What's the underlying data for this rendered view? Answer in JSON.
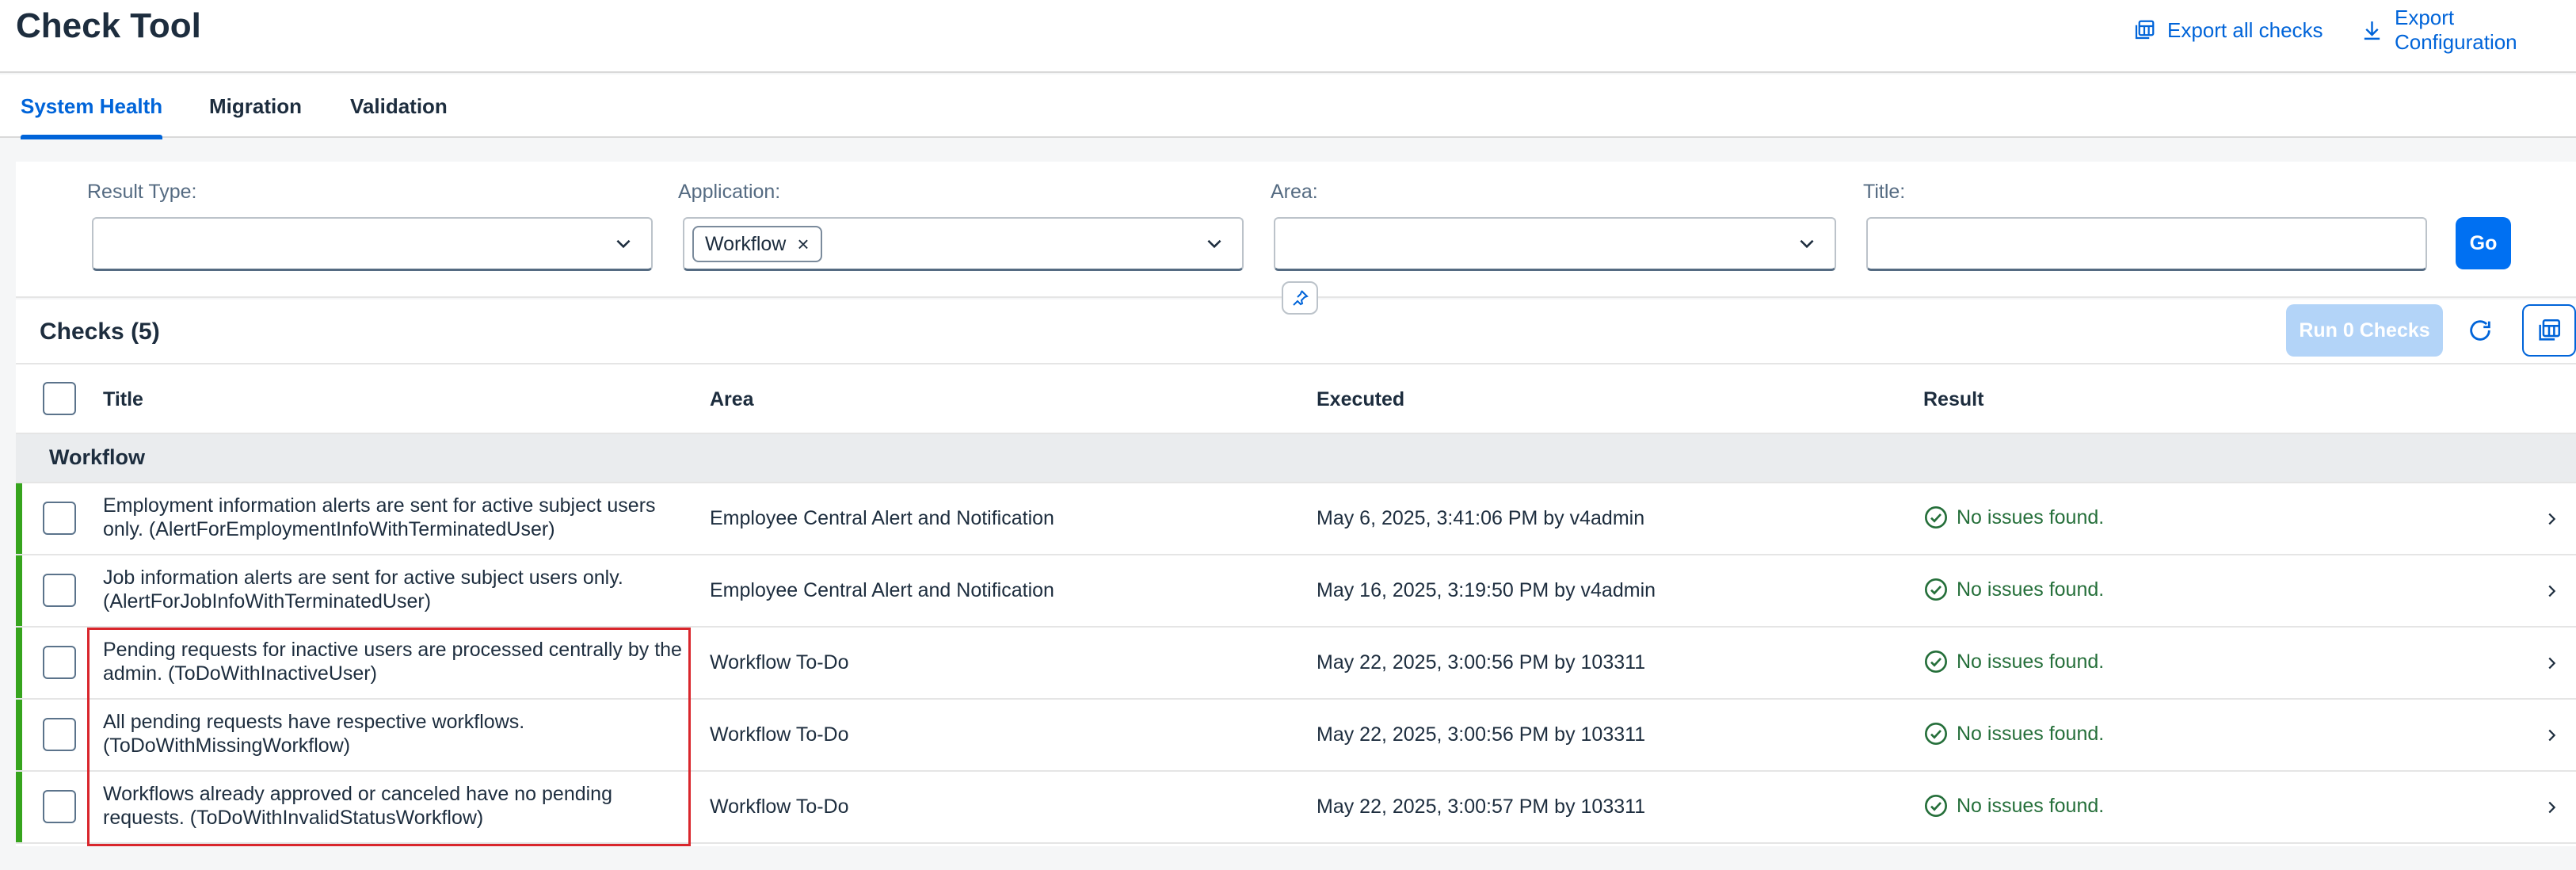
{
  "header": {
    "title": "Check Tool",
    "export_all_label": "Export all checks",
    "export_config_label": "Export Configuration"
  },
  "tabs": [
    {
      "label": "System Health",
      "active": true
    },
    {
      "label": "Migration",
      "active": false
    },
    {
      "label": "Validation",
      "active": false
    }
  ],
  "filters": {
    "result_type": {
      "label": "Result Type:",
      "value": ""
    },
    "application": {
      "label": "Application:",
      "token": "Workflow",
      "token_remove": "×"
    },
    "area": {
      "label": "Area:",
      "value": ""
    },
    "title": {
      "label": "Title:",
      "value": ""
    },
    "go_label": "Go"
  },
  "table": {
    "title": "Checks (5)",
    "run_label": "Run 0 Checks",
    "columns": [
      "Title",
      "Area",
      "Executed",
      "Result"
    ],
    "group": "Workflow",
    "rows": [
      {
        "title": "Employment information alerts are sent for active subject users only. (AlertForEmploymentInfoWithTerminatedUser)",
        "area": "Employee Central Alert and Notification",
        "executed": "May 6, 2025, 3:41:06 PM by v4admin",
        "result": "No issues found."
      },
      {
        "title": "Job information alerts are sent for active subject users only. (AlertForJobInfoWithTerminatedUser)",
        "area": "Employee Central Alert and Notification",
        "executed": "May 16, 2025, 3:19:50 PM by v4admin",
        "result": "No issues found."
      },
      {
        "title": "Pending requests for inactive users are processed centrally by the admin. (ToDoWithInactiveUser)",
        "area": "Workflow To-Do",
        "executed": "May 22, 2025, 3:00:56 PM by 103311",
        "result": "No issues found."
      },
      {
        "title": "All pending requests have respective workflows. (ToDoWithMissingWorkflow)",
        "area": "Workflow To-Do",
        "executed": "May 22, 2025, 3:00:56 PM by 103311",
        "result": "No issues found."
      },
      {
        "title": "Workflows already approved or canceled have no pending requests. (ToDoWithInvalidStatusWorkflow)",
        "area": "Workflow To-Do",
        "executed": "May 22, 2025, 3:00:57 PM by 103311",
        "result": "No issues found."
      }
    ]
  },
  "colors": {
    "accent": "#0064d9",
    "success": "#256f3a",
    "highlight_bar": "#36a41d",
    "annotation": "#d9262c"
  }
}
